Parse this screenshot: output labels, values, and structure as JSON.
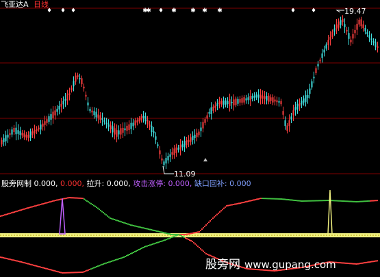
{
  "header": {
    "stock_name": "飞亚达A",
    "period": "日线",
    "stock_color": "#ffffff",
    "period_color": "#ff3030"
  },
  "price_chart": {
    "high_label": "19.47",
    "low_label": "11.09",
    "marker_glyphs": [
      "♦",
      "✱"
    ]
  },
  "indicator_bar": {
    "name": "股旁网制",
    "items": [
      {
        "label": "",
        "value": "0.000,",
        "color": "#ffffff"
      },
      {
        "label": "",
        "value": "0.000,",
        "color": "#ff3030"
      },
      {
        "label": "拉升:",
        "value": "0.000,",
        "color": "#ffffff"
      },
      {
        "label": "攻击涨停:",
        "value": "0.000,",
        "color": "#c060ff"
      },
      {
        "label": "缺口回补:",
        "value": "0.000",
        "color": "#80a0ff"
      }
    ]
  },
  "watermark": {
    "site": "股旁网",
    "url": "www.gupang.com"
  },
  "colors": {
    "up": "#ff4040",
    "down": "#40e0e0",
    "grid": "#800000",
    "green_line": "#40c040",
    "yellow_band": "#f0f080",
    "purple_spike": "#c060ff"
  }
}
